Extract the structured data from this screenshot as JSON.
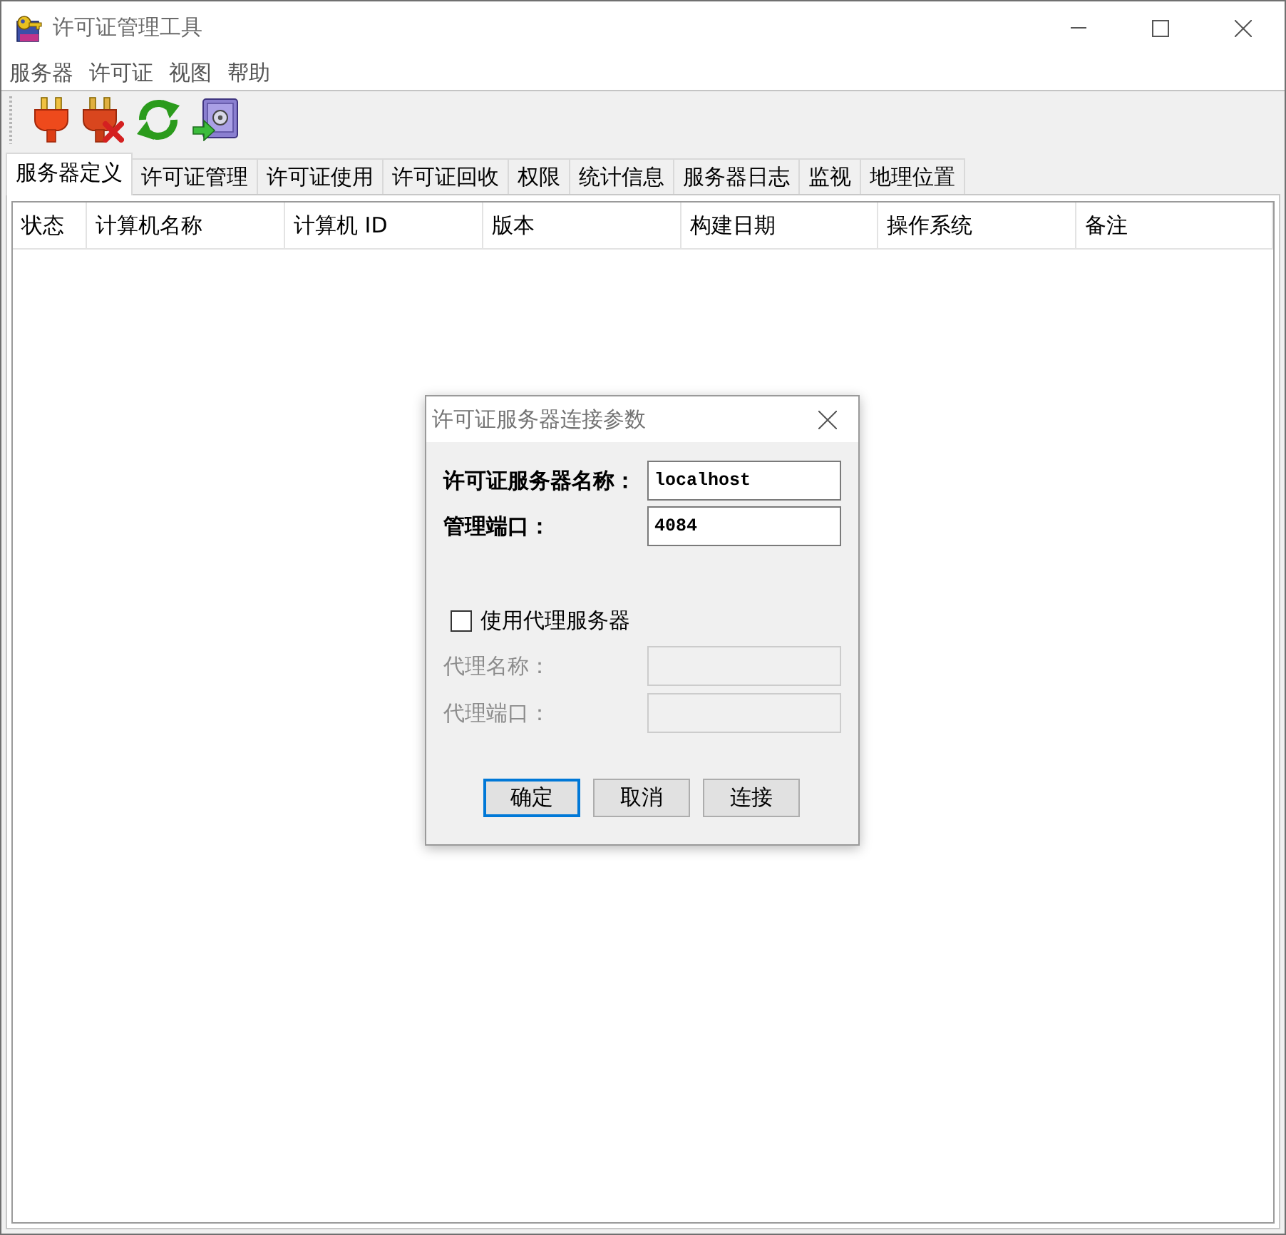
{
  "window": {
    "title": "许可证管理工具"
  },
  "menu_bar": [
    "服务器",
    "许可证",
    "视图",
    "帮助"
  ],
  "tabs": [
    {
      "label": "服务器定义",
      "selected": true
    },
    {
      "label": "许可证管理",
      "selected": false
    },
    {
      "label": "许可证使用",
      "selected": false
    },
    {
      "label": "许可证回收",
      "selected": false
    },
    {
      "label": "权限",
      "selected": false
    },
    {
      "label": "统计信息",
      "selected": false
    },
    {
      "label": "服务器日志",
      "selected": false
    },
    {
      "label": "监视",
      "selected": false
    },
    {
      "label": "地理位置",
      "selected": false
    }
  ],
  "table": {
    "columns": [
      "状态",
      "计算机名称",
      "计算机 ID",
      "版本",
      "构建日期",
      "操作系统",
      "备注"
    ]
  },
  "dialog": {
    "title": "许可证服务器连接参数",
    "fields": [
      {
        "label": "许可证服务器名称：",
        "value": "localhost",
        "disabled": false
      },
      {
        "label": "管理端口：",
        "value": "4084",
        "disabled": false
      }
    ],
    "proxy_checkbox": {
      "label": "使用代理服务器",
      "checked": false
    },
    "proxy_fields": [
      {
        "label": "代理名称：",
        "disabled": true
      },
      {
        "label": "代理端口：",
        "disabled": true
      }
    ],
    "buttons": [
      {
        "label": "确定",
        "default": true
      },
      {
        "label": "取消",
        "default": false
      },
      {
        "label": "连接",
        "default": false
      }
    ]
  }
}
